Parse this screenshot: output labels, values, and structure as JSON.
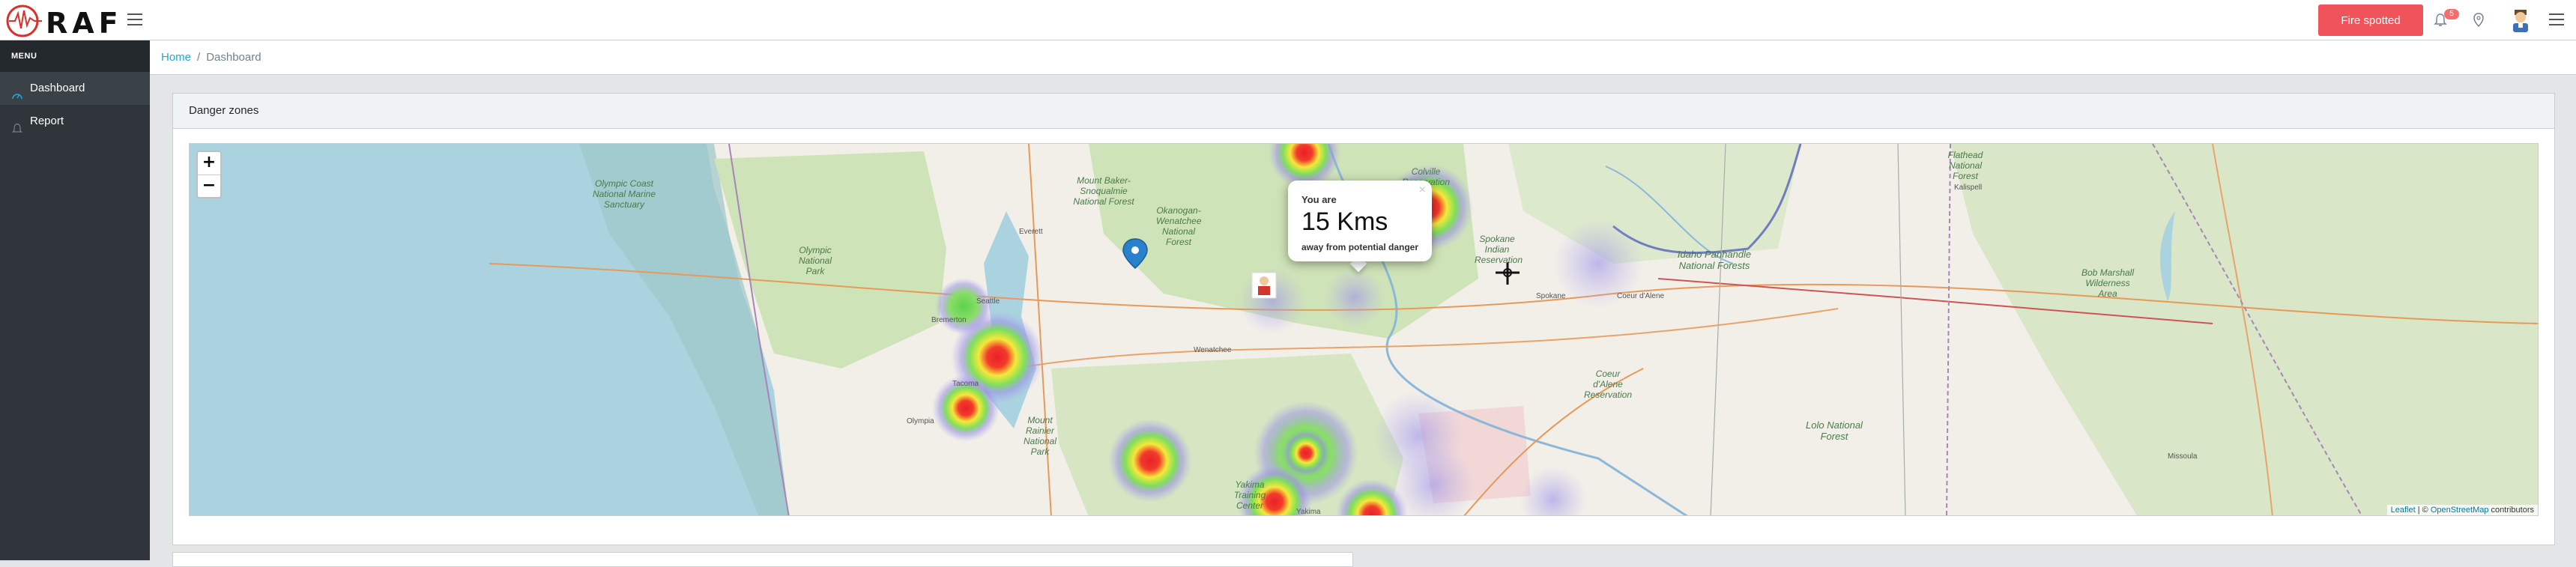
{
  "header": {
    "logo_text": "RAF",
    "fire_button_label": "Fire spotted",
    "notification_count": "5",
    "icons": [
      "hamburger-icon",
      "bell-icon",
      "location-pin-icon",
      "user-avatar",
      "hamburger-icon"
    ]
  },
  "sidebar": {
    "title": "MENU",
    "items": [
      {
        "label": "Dashboard",
        "icon": "speedometer-icon",
        "active": true
      },
      {
        "label": "Report",
        "icon": "bell-icon",
        "active": false
      }
    ]
  },
  "breadcrumb": {
    "home": "Home",
    "current": "Dashboard"
  },
  "card": {
    "title": "Danger zones"
  },
  "map": {
    "zoom_in": "+",
    "zoom_out": "−",
    "popup": {
      "line1": "You are",
      "distance": "15 Kms",
      "line3": "away from potential danger",
      "close": "×"
    },
    "attribution": {
      "leaflet": "Leaflet",
      "separator": " | © ",
      "osm": "OpenStreetMap",
      "suffix": " contributors"
    },
    "labels": [
      "Olympic Coast National Marine Sanctuary",
      "Olympic National Park",
      "Mount Baker-Snoqualmie National Forest",
      "Okanogan-Wenatchee National Forest",
      "Colville Reservation",
      "Spokane Indian Reservation",
      "Idaho Panhandle National Forests",
      "Flathead National Forest",
      "Bob Marshall Wilderness Area",
      "Lolo National Forest",
      "Mount Rainier National Park",
      "Coeur d'Alene Reservation",
      "Yakima Training Center"
    ],
    "cities": [
      "Everett",
      "Seattle",
      "Bremerton",
      "Tacoma",
      "Olympia",
      "Wenatchee",
      "Spokane",
      "Coeur d'Alene",
      "Kalispell",
      "Missoula",
      "Yakima"
    ],
    "colors": {
      "water": "#aad3df",
      "land": "#f2efe9",
      "forest": "#cfe3b8",
      "heat_core": "#e8202a"
    }
  }
}
